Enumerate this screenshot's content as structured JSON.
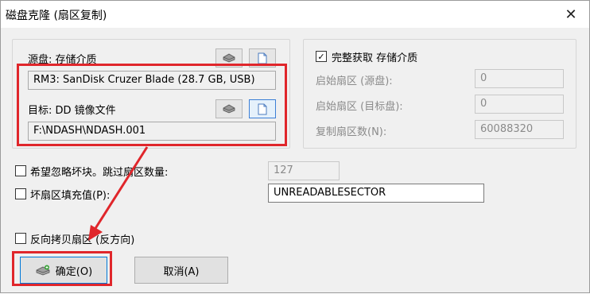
{
  "window": {
    "title": "磁盘克隆 (扇区复制)",
    "close_glyph": "✕"
  },
  "source": {
    "label": "源盘: 存储介质",
    "value": "RM3: SanDisk Cruzer Blade (28.7 GB, USB)"
  },
  "target": {
    "label": "目标: DD 镜像文件",
    "value": "F:\\NDASH\\NDASH.001"
  },
  "full_media": {
    "checkbox_label": "完整获取 存储介质",
    "checked": true,
    "start_source_label": "启始扇区 (源盘):",
    "start_source_value": "0",
    "start_target_label": "启始扇区 (目标盘):",
    "start_target_value": "0",
    "count_label": "复制扇区数(N):",
    "count_value": "60088320"
  },
  "options": {
    "skip_bad_label": "希望忽略坏块。跳过扇区数量:",
    "skip_bad_value": "127",
    "fill_bad_label": "坏扇区填充值(P):",
    "fill_bad_value": "UNREADABLESECTOR",
    "reverse_label": "反向拷贝扇区 (反方向)"
  },
  "buttons": {
    "ok_label": "确定(O)",
    "cancel_label": "取消(A)"
  },
  "annotation_color": "#e0262b"
}
